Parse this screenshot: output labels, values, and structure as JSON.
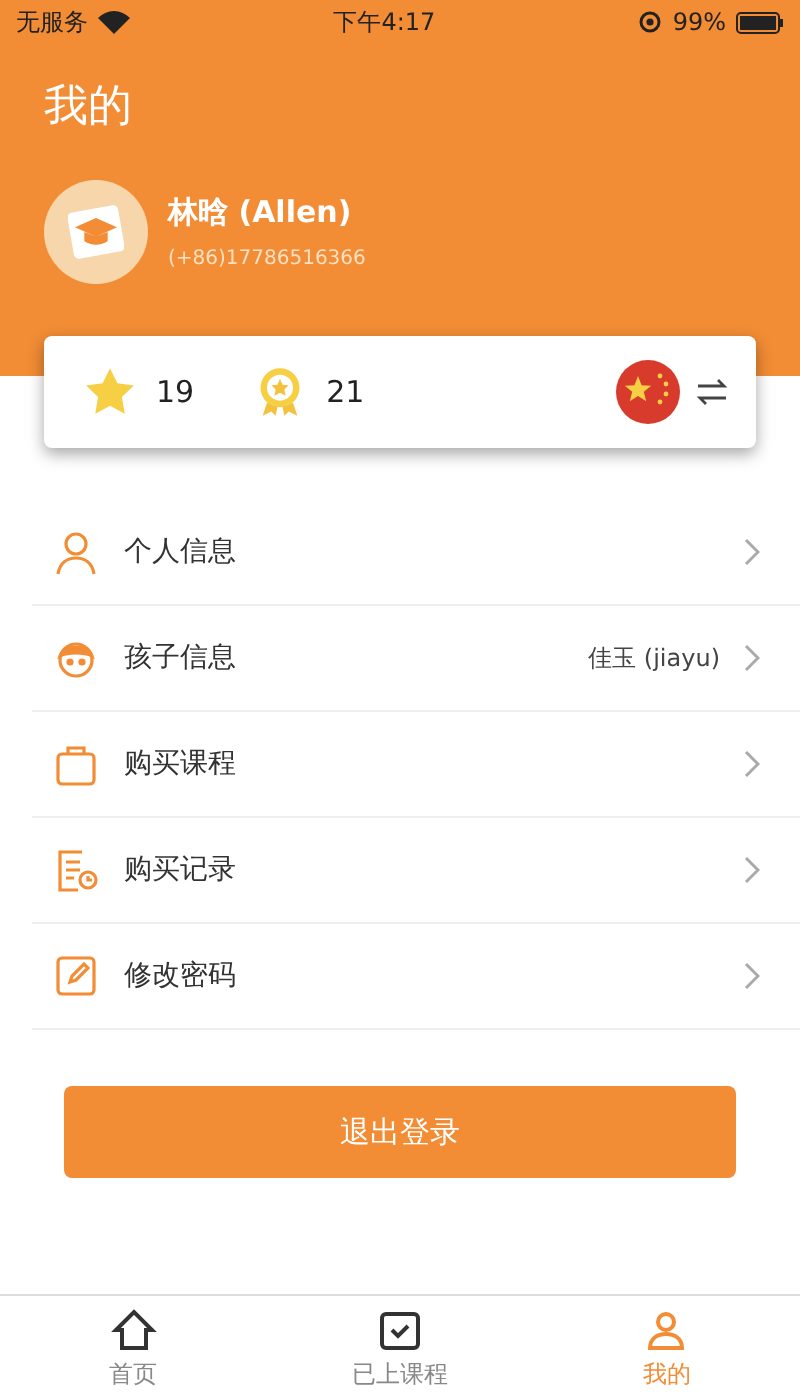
{
  "status_bar": {
    "carrier": "无服务",
    "time": "下午4:17",
    "battery": "99%"
  },
  "title": "我的",
  "profile": {
    "name": "林晗 (Allen)",
    "phone": "(+86)17786516366"
  },
  "stats": [
    {
      "kind": "star",
      "value": "19"
    },
    {
      "kind": "medal",
      "value": "21"
    }
  ],
  "menu": [
    {
      "kind": "person",
      "label": "个人信息"
    },
    {
      "kind": "child",
      "label": "孩子信息",
      "value": "佳玉 (jiayu)"
    },
    {
      "kind": "bag",
      "label": "购买课程"
    },
    {
      "kind": "record",
      "label": "购买记录"
    },
    {
      "kind": "edit",
      "label": "修改密码"
    }
  ],
  "logout_button": "退出登录",
  "tabs": [
    {
      "kind": "home",
      "label": "首页",
      "selected": false
    },
    {
      "kind": "course",
      "label": "已上课程",
      "selected": false
    },
    {
      "kind": "me",
      "label": "我的",
      "selected": true
    }
  ]
}
